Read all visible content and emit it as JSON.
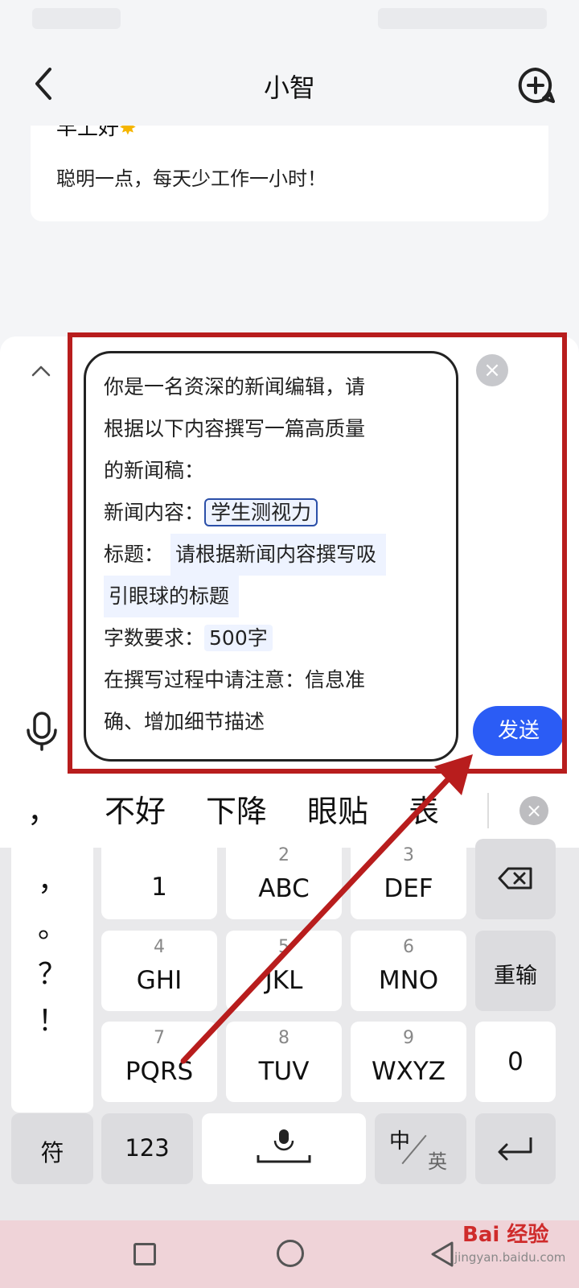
{
  "header": {
    "title": "小智"
  },
  "welcome": {
    "greeting": "早上好",
    "subtitle": "聪明一点，每天少工作一小时！"
  },
  "prompt": {
    "line1": "你是一名资深的新闻编辑，请",
    "line2": "根据以下内容撰写一篇高质量",
    "line3": "的新闻稿：",
    "news_label": "新闻内容：",
    "news_value": "学生测视力",
    "title_label": "标题：",
    "title_value_line1": "请根据新闻内容撰写吸",
    "title_value_line2": "引眼球的标题",
    "words_label": "字数要求：",
    "words_value": "500字",
    "note_line1": "在撰写过程中请注意：信息准",
    "note_line2": "确、增加细节描述"
  },
  "actions": {
    "send_label": "发送",
    "clear_symbol": "×"
  },
  "candidates": {
    "comma": "，",
    "items": [
      "不好",
      "下降",
      "眼贴",
      "表"
    ]
  },
  "keyboard": {
    "punct": [
      "，",
      "。",
      "？",
      "！"
    ],
    "keys": [
      {
        "num": "",
        "letters": "1"
      },
      {
        "num": "2",
        "letters": "ABC"
      },
      {
        "num": "3",
        "letters": "DEF"
      },
      {
        "num": "4",
        "letters": "GHI"
      },
      {
        "num": "5",
        "letters": "JKL"
      },
      {
        "num": "6",
        "letters": "MNO"
      },
      {
        "num": "7",
        "letters": "PQRS"
      },
      {
        "num": "8",
        "letters": "TUV"
      },
      {
        "num": "9",
        "letters": "WXYZ"
      }
    ],
    "reinput": "重输",
    "zero": "0",
    "symbols": "符",
    "numbers": "123",
    "lang_zh": "中",
    "lang_en": "英"
  },
  "watermark": {
    "text": "Bai 经验",
    "sub": "jingyan.baidu.com"
  },
  "colors": {
    "accent": "#2b5cf5",
    "highlight": "#b81d1d",
    "arrow": "#b81d1d"
  }
}
